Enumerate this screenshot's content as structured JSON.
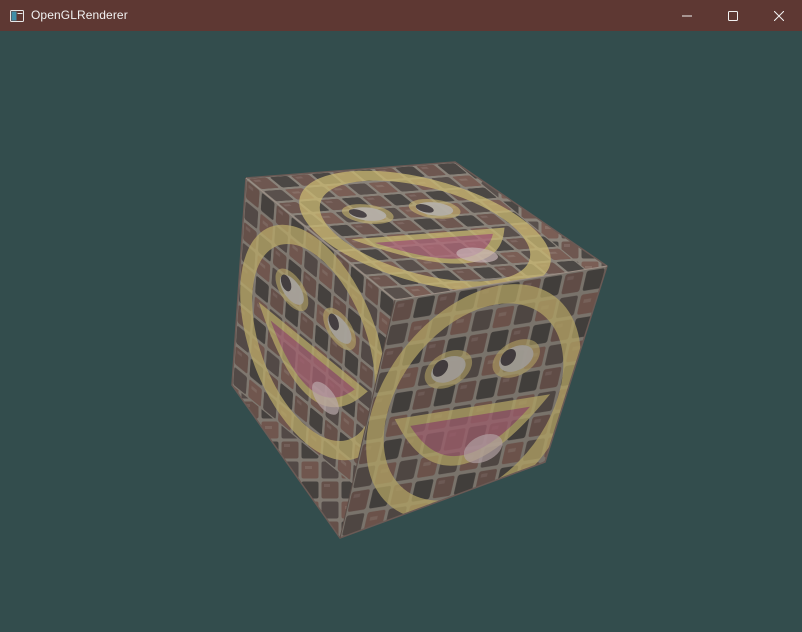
{
  "window": {
    "title": "OpenGLRenderer",
    "icon": "app-window-icon",
    "controls": {
      "minimize_icon": "minimize-icon",
      "maximize_icon": "maximize-icon",
      "close_icon": "close-icon"
    }
  },
  "viewport": {
    "clear_color": "#334d4d",
    "object": "textured-cube"
  },
  "colors": {
    "titlebar": "#5e3833",
    "title_text": "#f2f2f2",
    "brick": "#6e5750",
    "brick_dark": "#4b4744",
    "mortar": "#8a837a",
    "smiley_yellow": "#c9b872",
    "smiley_pink": "#b06a7a"
  }
}
